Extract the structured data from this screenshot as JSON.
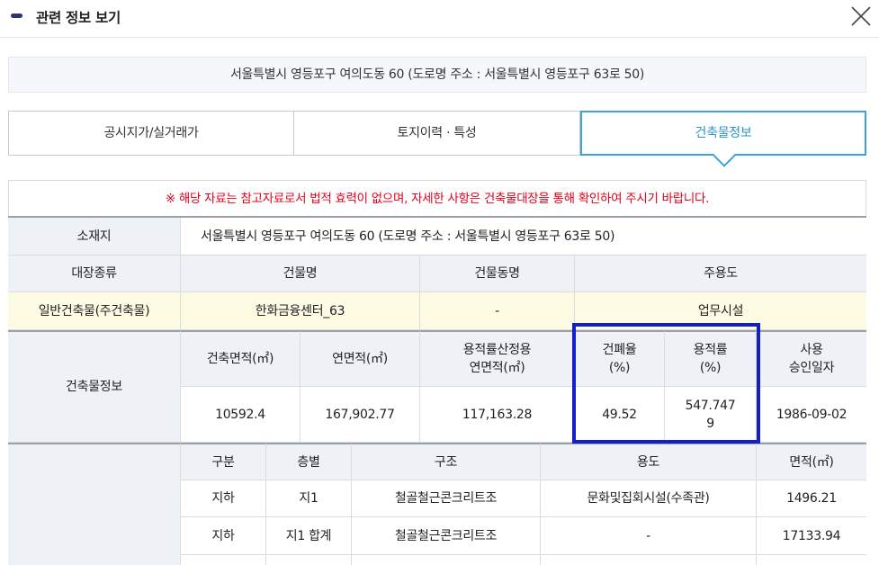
{
  "header": {
    "title": "관련 정보 보기",
    "close_icon": "close-icon"
  },
  "address_bar": "서울특별시 영등포구 여의도동 60 (도로명 주소 : 서울특별시 영등포구 63로 50)",
  "tabs": [
    {
      "label": "공시지가/실거래가",
      "active": false
    },
    {
      "label": "토지이력 · 특성",
      "active": false
    },
    {
      "label": "건축물정보",
      "active": true
    }
  ],
  "notice": "※ 해당 자료는 참고자료로서 법적 효력이 없으며, 자세한 사항은 건축물대장을 통해 확인하여 주시기 바랍니다.",
  "colors": {
    "accent": "#3ea3d6",
    "notice": "#e3001b",
    "highlight": "#1320c8",
    "header_bg": "#eef1f6",
    "row_yellow": "#fdfbe3"
  },
  "info": {
    "location_label": "소재지",
    "location_value": "서울특별시 영등포구 여의도동 60 (도로명 주소 : 서울특별시 영등포구 63로 50)",
    "register_type_label": "대장종류",
    "building_name_label": "건물명",
    "building_dong_label": "건물동명",
    "main_use_label": "주용도",
    "register_type_value": "일반건축물(주건축물)",
    "building_name_value": "한화금융센터_63",
    "building_dong_value": "-",
    "main_use_value": "업무시설"
  },
  "building_info": {
    "section_label": "건축물정보",
    "headers": [
      "건축면적(㎡)",
      "연면적(㎡)",
      "용적률산정용\n연면적(㎡)",
      "건폐율\n(%)",
      "용적률\n(%)",
      "사용\n승인일자"
    ],
    "values": [
      "10592.4",
      "167,902.77",
      "117,163.28",
      "49.52",
      "547.747\n9",
      "1986-09-02"
    ]
  },
  "floors": {
    "headers": [
      "구분",
      "층별",
      "구조",
      "용도",
      "면적(㎡)"
    ],
    "rows": [
      [
        "지하",
        "지1",
        "철골철근콘크리트조",
        "문화및집회시설(수족관)",
        "1496.21"
      ],
      [
        "지하",
        "지1 합계",
        "철골철근콘크리트조",
        "-",
        "17133.94"
      ]
    ]
  }
}
